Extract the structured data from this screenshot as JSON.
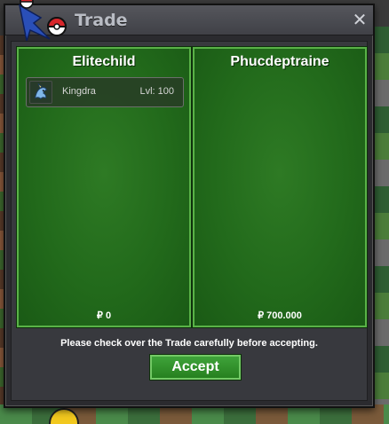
{
  "window": {
    "title": "Trade",
    "close_glyph": "✕",
    "logo_icon": "pokemon-logo-icon",
    "close_icon": "close-icon"
  },
  "left_side": {
    "trainer_name": "Elitechild",
    "items": [
      {
        "pokemon": "Kingdra",
        "level_label": "Lvl: 100",
        "icon": "kingdra-icon"
      }
    ],
    "money": "₽ 0"
  },
  "right_side": {
    "trainer_name": "Phucdeptraine",
    "items": [],
    "money": "₽ 700.000"
  },
  "footer": {
    "notice": "Please check over the Trade carefully before accepting.",
    "accept_label": "Accept"
  },
  "colors": {
    "panel_green": "#226a1b",
    "panel_border": "#59b247",
    "button_green": "#3fa33a",
    "dialog_bg": "#2b2b2f"
  }
}
